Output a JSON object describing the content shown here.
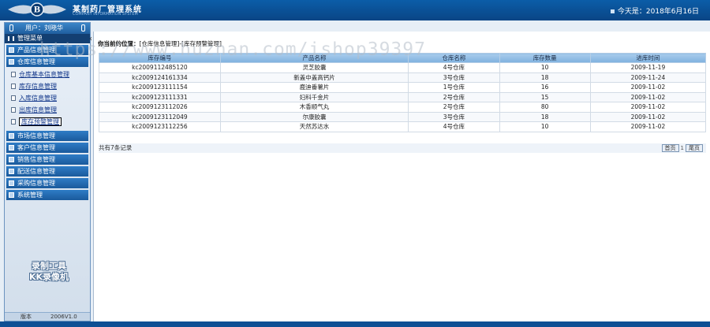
{
  "header": {
    "title": "某制药厂管理系统",
    "subtitle": "COMPANY INFORMATION SYSTEM",
    "date_text": "今天是：2018年6月16日"
  },
  "sidebar": {
    "user_label": "用户：刘晓华",
    "menu_title": "管理菜单",
    "categories_top": [
      {
        "label": "产品信息管理"
      },
      {
        "label": "仓库信息管理"
      }
    ],
    "subitems": [
      {
        "label": "仓库基本信息管理"
      },
      {
        "label": "库存信息管理"
      },
      {
        "label": "入库信息管理"
      },
      {
        "label": "出库信息管理"
      },
      {
        "label": "库存预警管理"
      }
    ],
    "categories_bottom": [
      {
        "label": "市场信息管理"
      },
      {
        "label": "客户信息管理"
      },
      {
        "label": "销售信息管理"
      },
      {
        "label": "配送信息管理"
      },
      {
        "label": "采购信息管理"
      },
      {
        "label": "系统管理"
      }
    ],
    "stamp_line1": "录制工具",
    "stamp_line2": "KK录像机",
    "footer_left": "版本",
    "footer_version": "2006V1.0"
  },
  "main": {
    "breadcrumb_prefix": "你当前的位置：",
    "breadcrumb_path": "[仓库信息管理]-[库存预警管理]",
    "columns": [
      "库存编号",
      "产品名称",
      "仓库名称",
      "库存数量",
      "进库时间"
    ],
    "rows": [
      [
        "kc2009112485120",
        "灵芝胶囊",
        "4号仓库",
        "10",
        "2009-11-19"
      ],
      [
        "kc2009124161334",
        "新盖中盖高钙片",
        "3号仓库",
        "18",
        "2009-11-24"
      ],
      [
        "kc2009123111154",
        "鹿迪番薯片",
        "1号仓库",
        "16",
        "2009-11-02"
      ],
      [
        "kc2009123111331",
        "妇科千金片",
        "2号仓库",
        "15",
        "2009-11-02"
      ],
      [
        "kc2009123112026",
        "木香顺气丸",
        "2号仓库",
        "80",
        "2009-11-02"
      ],
      [
        "kc2009123112049",
        "尔康胶囊",
        "3号仓库",
        "18",
        "2009-11-02"
      ],
      [
        "kc2009123112256",
        "天然苏达水",
        "4号仓库",
        "10",
        "2009-11-02"
      ]
    ],
    "record_count": "共有7条记录",
    "pager": {
      "first": "首页",
      "page": "1",
      "last": "尾页"
    }
  },
  "watermark": "https://www.huzhan.com/ishop39397"
}
